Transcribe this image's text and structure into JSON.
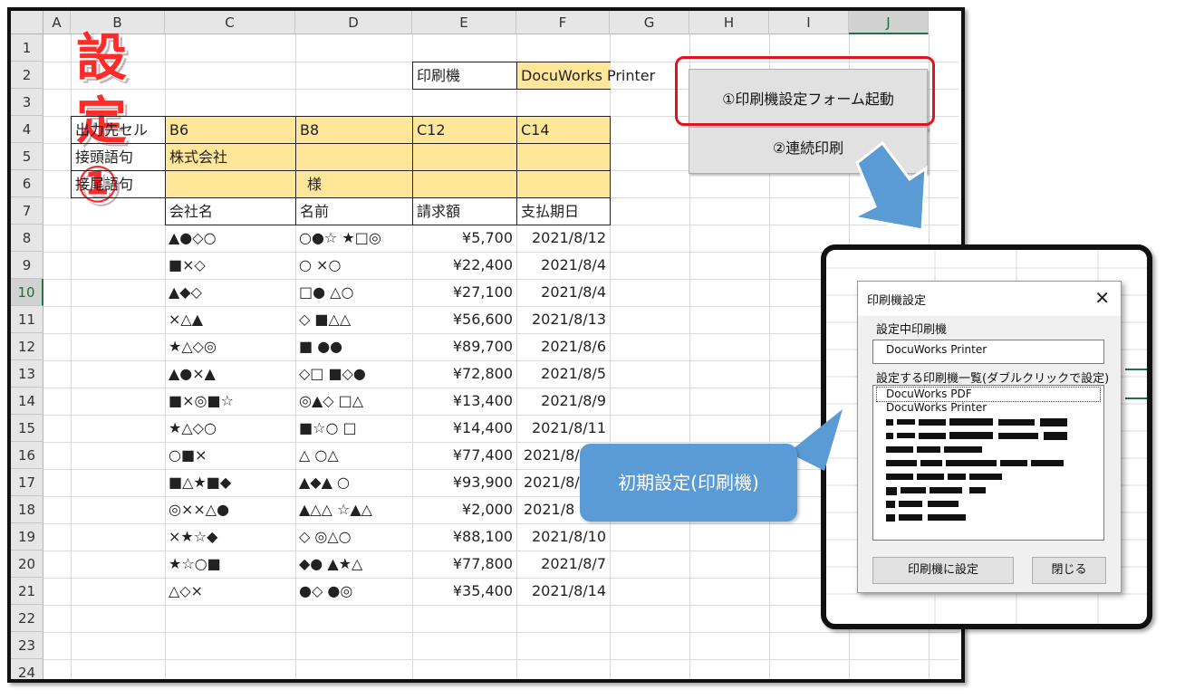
{
  "title": "設定①",
  "columns": [
    "A",
    "B",
    "C",
    "D",
    "E",
    "F",
    "G",
    "H",
    "I",
    "J"
  ],
  "selected_column": "J",
  "rows": [
    "1",
    "2",
    "3",
    "4",
    "5",
    "6",
    "7",
    "8",
    "9",
    "10",
    "11",
    "12",
    "13",
    "14",
    "15",
    "16",
    "17",
    "18",
    "19",
    "20",
    "21",
    "22",
    "23",
    "24"
  ],
  "selected_row": "10",
  "printer_label": "印刷機",
  "printer_value": "DocuWorks Printer",
  "settings_table": {
    "output_label": "出力先セル",
    "output_cells": [
      "B6",
      "B8",
      "C12",
      "C14"
    ],
    "prefix_label": "接頭語句",
    "prefix_value": "株式会社",
    "suffix_label": "接尾語句",
    "suffix_value": "様"
  },
  "headers": [
    "会社名",
    "名前",
    "請求額",
    "支払期日"
  ],
  "data_rows": [
    {
      "company": "▲●◇○",
      "name": "○●☆ ★□◎",
      "amount": "¥5,700",
      "due": "2021/8/12"
    },
    {
      "company": "■×◇",
      "name": "○ ×○",
      "amount": "¥22,400",
      "due": "2021/8/4"
    },
    {
      "company": "▲◆◇",
      "name": "□● △○",
      "amount": "¥27,100",
      "due": "2021/8/4"
    },
    {
      "company": "×△▲",
      "name": "◇ ■△△",
      "amount": "¥56,600",
      "due": "2021/8/13"
    },
    {
      "company": "★△◇◎",
      "name": "■ ●●",
      "amount": "¥89,700",
      "due": "2021/8/6"
    },
    {
      "company": "▲●×▲",
      "name": "◇□ ■◇●",
      "amount": "¥72,800",
      "due": "2021/8/5"
    },
    {
      "company": "■×◎■☆",
      "name": "◎▲◇ □△",
      "amount": "¥13,400",
      "due": "2021/8/9"
    },
    {
      "company": "★△◇○",
      "name": "■☆○ □",
      "amount": "¥14,400",
      "due": "2021/8/11"
    },
    {
      "company": "○■×",
      "name": "△ ○△",
      "amount": "¥77,400",
      "due": "2021/8/6"
    },
    {
      "company": "■△★■◆",
      "name": "▲◆▲ ○",
      "amount": "¥93,900",
      "due": "2021/8/"
    },
    {
      "company": "◎××△●",
      "name": "▲△△ ☆▲△",
      "amount": "¥2,000",
      "due": "2021/8"
    },
    {
      "company": "×★☆◆",
      "name": "◇ ◎△○",
      "amount": "¥88,100",
      "due": "2021/8/10"
    },
    {
      "company": "★☆○■",
      "name": "◆● ▲★△",
      "amount": "¥77,800",
      "due": "2021/8/7"
    },
    {
      "company": "△◇×",
      "name": "●◇ ●◎",
      "amount": "¥35,400",
      "due": "2021/8/14"
    }
  ],
  "buttons": {
    "launch_form": "①印刷機設定フォーム起動",
    "continuous_print": "②連続印刷"
  },
  "dialog": {
    "title": "印刷機設定",
    "close": "✕",
    "current_label": "設定中印刷機",
    "current_value": "DocuWorks Printer",
    "list_label": "設定する印刷機一覧(ダブルクリックで設定)",
    "printers": [
      "DocuWorks PDF",
      "DocuWorks Printer"
    ],
    "set_button": "印刷機に設定",
    "close_button": "閉じる"
  },
  "callout": "初期設定(印刷機)",
  "colors": {
    "title_red": "#ff2b2b",
    "fill_yellow": "#ffe699",
    "callout_blue": "#5b9bd5",
    "highlight_red": "#e0141e"
  }
}
